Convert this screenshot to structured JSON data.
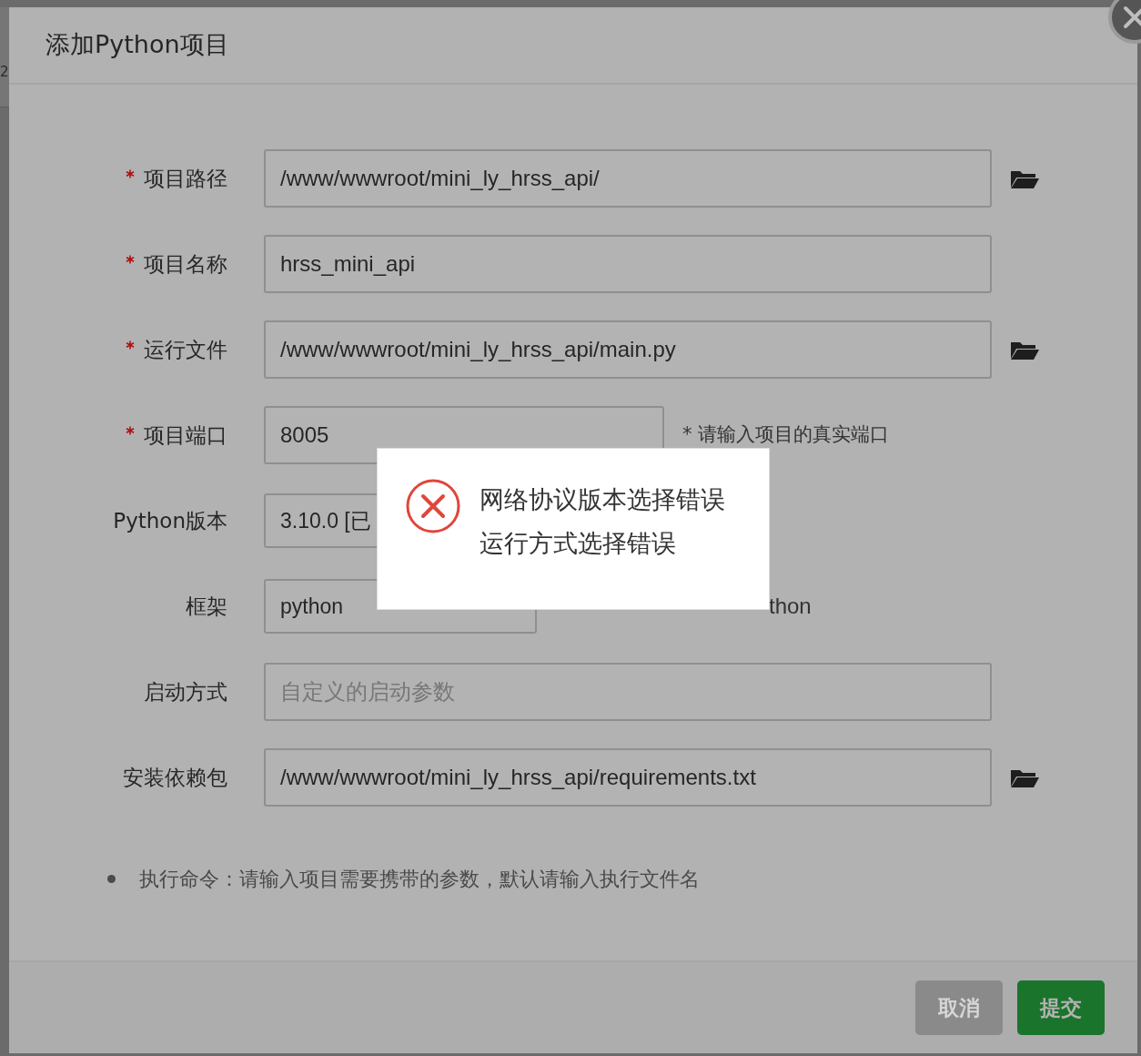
{
  "background": {
    "row_cell": "2"
  },
  "dialog": {
    "title": "添加Python项目",
    "fields": [
      {
        "label": "项目路径",
        "required": true,
        "kind": "path",
        "value": "/www/wwwroot/mini_ly_hrss_api/"
      },
      {
        "label": "项目名称",
        "required": true,
        "kind": "text",
        "value": "hrss_mini_api"
      },
      {
        "label": "运行文件",
        "required": true,
        "kind": "path",
        "value": "/www/wwwroot/mini_ly_hrss_api/main.py"
      },
      {
        "label": "项目端口",
        "required": true,
        "kind": "port",
        "value": "8005",
        "hint": "* 请输入项目的真实端口"
      },
      {
        "label": "Python版本",
        "required": false,
        "kind": "select",
        "value": "3.10.0 [已"
      },
      {
        "label": "框架",
        "required": false,
        "kind": "select",
        "value": "python",
        "hint": "thon"
      },
      {
        "label": "启动方式",
        "required": false,
        "kind": "text",
        "placeholder": "自定义的启动参数"
      },
      {
        "label": "安装依赖包",
        "required": false,
        "kind": "path",
        "value": "/www/wwwroot/mini_ly_hrss_api/requirements.txt"
      }
    ],
    "notes": [
      "执行命令：请输入项目需要携带的参数，默认请输入执行文件名"
    ],
    "buttons": [
      {
        "label": "取消",
        "kind": "cancel"
      },
      {
        "label": "提交",
        "kind": "submit"
      }
    ]
  },
  "toast": {
    "kind": "error",
    "messages": [
      "网络协议版本选择错误",
      "运行方式选择错误"
    ]
  }
}
